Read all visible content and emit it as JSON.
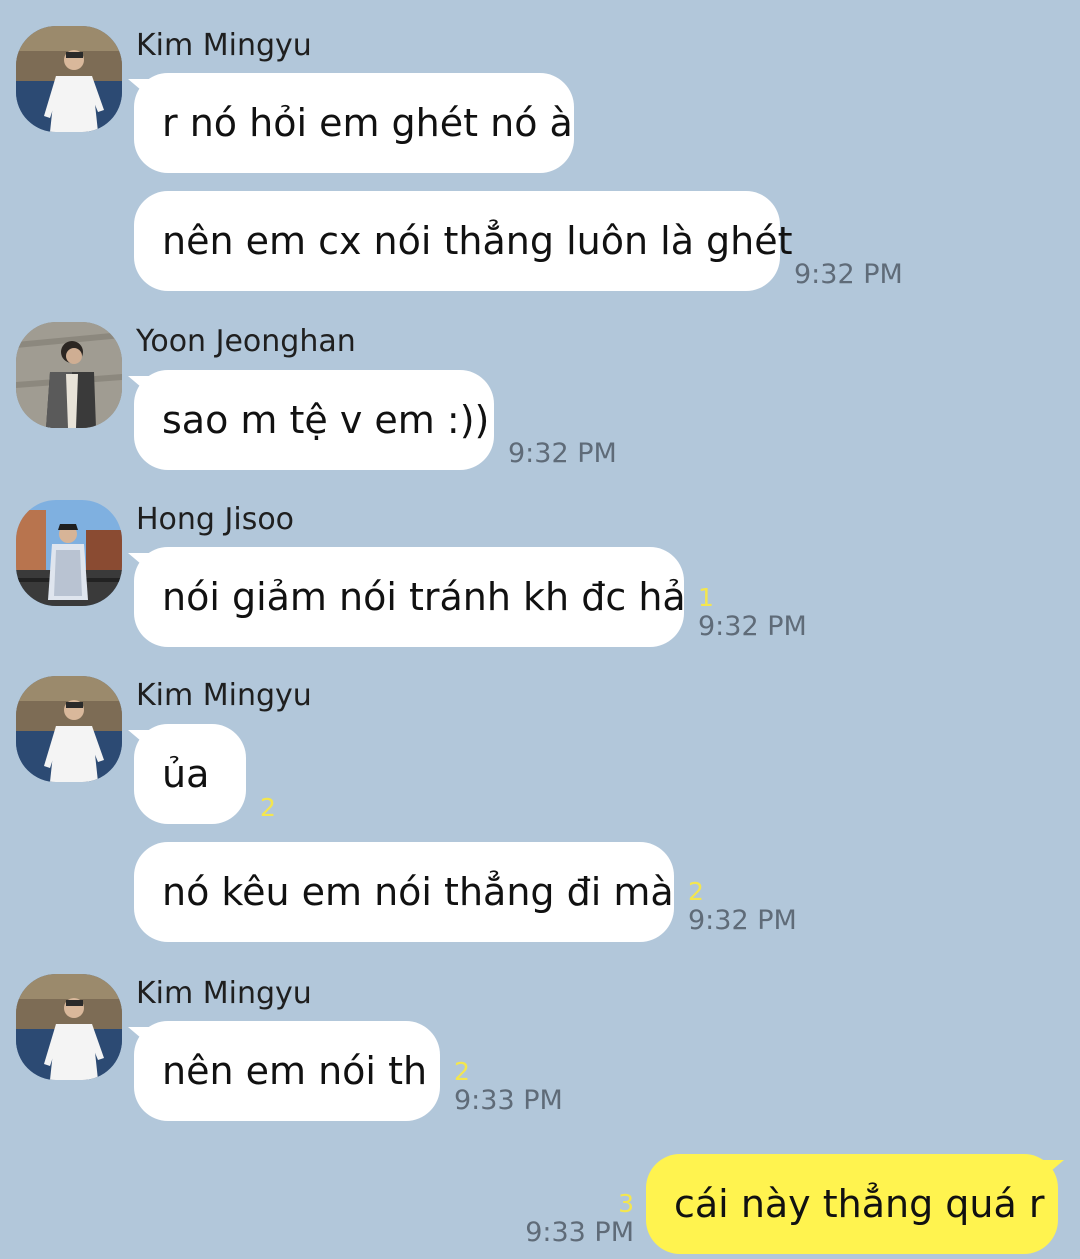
{
  "chat": {
    "messages": [
      {
        "sender": "Kim Mingyu",
        "text": "r nó hỏi em ghét nó à",
        "time": "",
        "unread": ""
      },
      {
        "sender": "",
        "text": "nên em cx nói thẳng luôn là ghét",
        "time": "9:32 PM",
        "unread": ""
      },
      {
        "sender": "Yoon Jeonghan",
        "text": "sao m tệ v em :))",
        "time": "9:32 PM",
        "unread": ""
      },
      {
        "sender": "Hong Jisoo",
        "text": "nói giảm nói tránh kh đc hả",
        "time": "9:32 PM",
        "unread": "1"
      },
      {
        "sender": "Kim Mingyu",
        "text": "ủa",
        "time": "",
        "unread": "2"
      },
      {
        "sender": "",
        "text": "nó kêu em nói thẳng đi mà",
        "time": "9:32 PM",
        "unread": "2"
      },
      {
        "sender": "Kim Mingyu",
        "text": "nên em nói th",
        "time": "9:33 PM",
        "unread": "2"
      },
      {
        "sender": "",
        "text": "cái này thẳng quá r",
        "time": "9:33 PM",
        "unread": "3"
      }
    ]
  },
  "colors": {
    "background": "#b2c7da",
    "incoming_bubble": "#ffffff",
    "outgoing_bubble": "#fff34f",
    "unread_count": "#f4e64e",
    "timestamp": "#5f6b78"
  }
}
